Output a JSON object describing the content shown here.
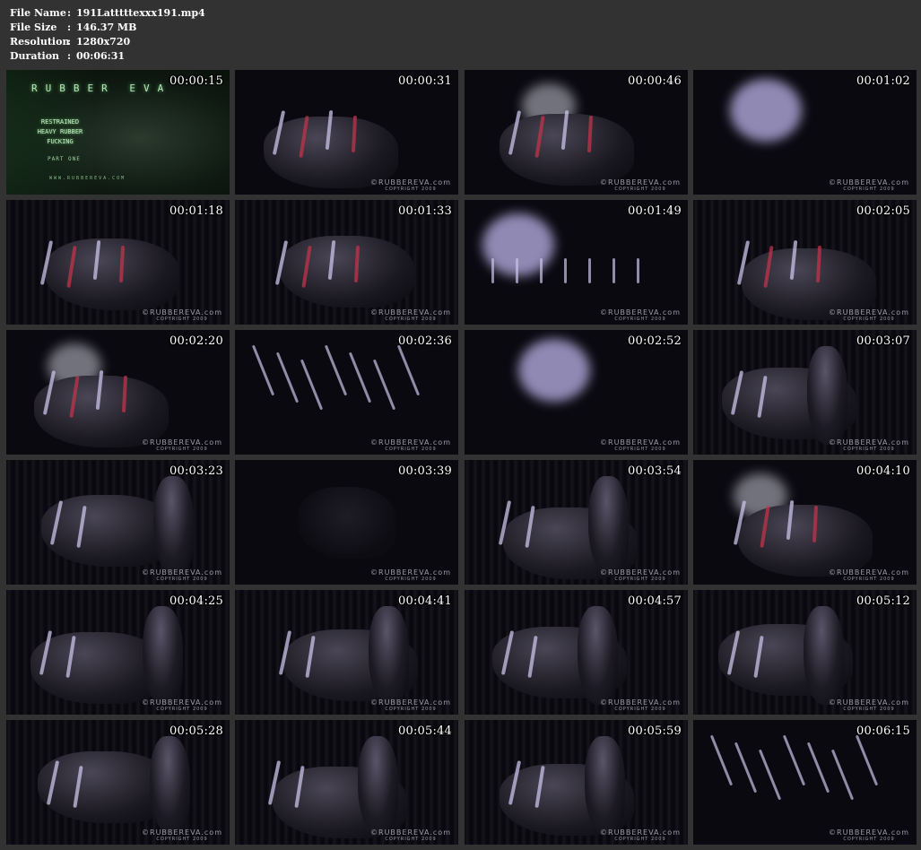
{
  "file_info": [
    {
      "label": "File Name",
      "value": "191Latttttexxx191.mp4"
    },
    {
      "label": "File Size",
      "value": "146.37 MB"
    },
    {
      "label": "Resolution",
      "value": "1280x720"
    },
    {
      "label": "Duration",
      "value": "00:06:31"
    }
  ],
  "separator": ":",
  "title_card": {
    "brand": "RUBBER EVA",
    "title": "RESTRAINED\nHEAVY RUBBER\nFUCKING",
    "part": "PART ONE",
    "url": "WWW.RUBBEREVA.COM"
  },
  "watermark": {
    "brand": "©RUBBEREVA.com",
    "copyright": "COPYRIGHT 2009"
  },
  "colors": {
    "background": "#323232",
    "text": "#ffffff",
    "title_green": "#b8e4b8",
    "latex_highlight": "#c9c3e8",
    "strap_red": "#c2334a"
  },
  "thumbnails": [
    {
      "time": "00:00:15",
      "scene": "title",
      "watermark": false
    },
    {
      "time": "00:00:31",
      "scene": "straps",
      "watermark": true
    },
    {
      "time": "00:00:46",
      "scene": "face-straps",
      "watermark": true
    },
    {
      "time": "00:01:02",
      "scene": "face-glow",
      "watermark": true
    },
    {
      "time": "00:01:18",
      "scene": "body-straps",
      "watermark": true
    },
    {
      "time": "00:01:33",
      "scene": "body-straps",
      "watermark": true
    },
    {
      "time": "00:01:49",
      "scene": "face-dark",
      "watermark": true
    },
    {
      "time": "00:02:05",
      "scene": "body-straps",
      "watermark": true
    },
    {
      "time": "00:02:20",
      "scene": "face-straps",
      "watermark": true
    },
    {
      "time": "00:02:36",
      "scene": "buckles",
      "watermark": true
    },
    {
      "time": "00:02:52",
      "scene": "face-glow",
      "watermark": true
    },
    {
      "time": "00:03:07",
      "scene": "figure-curtain",
      "watermark": true
    },
    {
      "time": "00:03:23",
      "scene": "figure-curtain",
      "watermark": true
    },
    {
      "time": "00:03:39",
      "scene": "dark",
      "watermark": true
    },
    {
      "time": "00:03:54",
      "scene": "figure-curtain",
      "watermark": true
    },
    {
      "time": "00:04:10",
      "scene": "face-straps",
      "watermark": true
    },
    {
      "time": "00:04:25",
      "scene": "figure-curtain",
      "watermark": true
    },
    {
      "time": "00:04:41",
      "scene": "figure-curtain",
      "watermark": true
    },
    {
      "time": "00:04:57",
      "scene": "figure-curtain",
      "watermark": true
    },
    {
      "time": "00:05:12",
      "scene": "figure-curtain",
      "watermark": true
    },
    {
      "time": "00:05:28",
      "scene": "figure-curtain",
      "watermark": true
    },
    {
      "time": "00:05:44",
      "scene": "figure-curtain",
      "watermark": true
    },
    {
      "time": "00:05:59",
      "scene": "figure-curtain",
      "watermark": true
    },
    {
      "time": "00:06:15",
      "scene": "buckles",
      "watermark": true
    }
  ]
}
